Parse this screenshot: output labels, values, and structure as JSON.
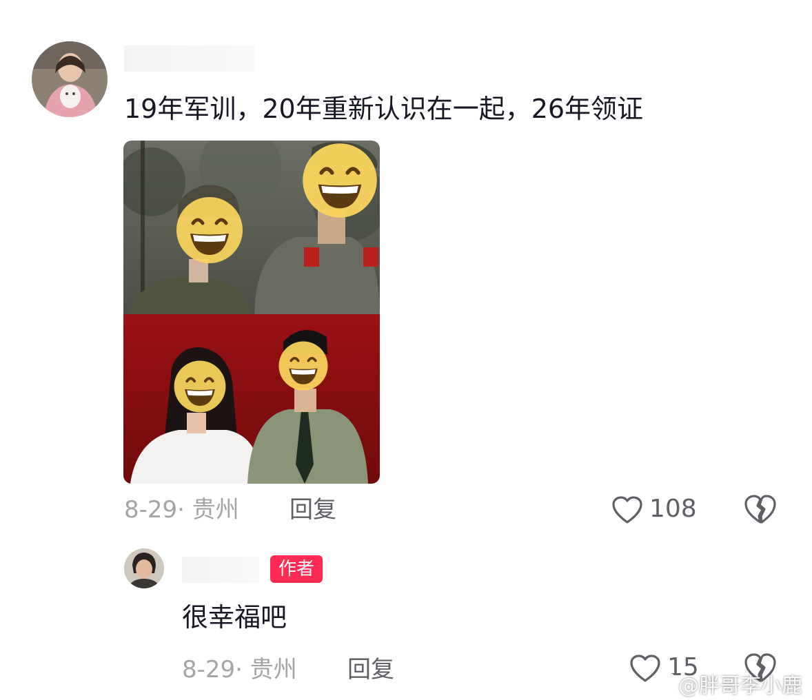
{
  "comment": {
    "text": "19年军训，20年重新认识在一起，26年领证",
    "date_location": "8-29· 贵州",
    "reply_label": "回复",
    "like_count": "108"
  },
  "reply": {
    "author_badge": "作者",
    "text": "很幸福吧",
    "date_location": "8-29· 贵州",
    "reply_label": "回复",
    "like_count": "15"
  },
  "watermark": "@胖哥李小鹿",
  "colors": {
    "badge": "#fe2c55",
    "meta": "#a3a3a8",
    "backdrop_red": "#8a0c0e"
  },
  "icons": [
    "heart-outline-icon",
    "broken-heart-icon",
    "weibo-icon"
  ]
}
